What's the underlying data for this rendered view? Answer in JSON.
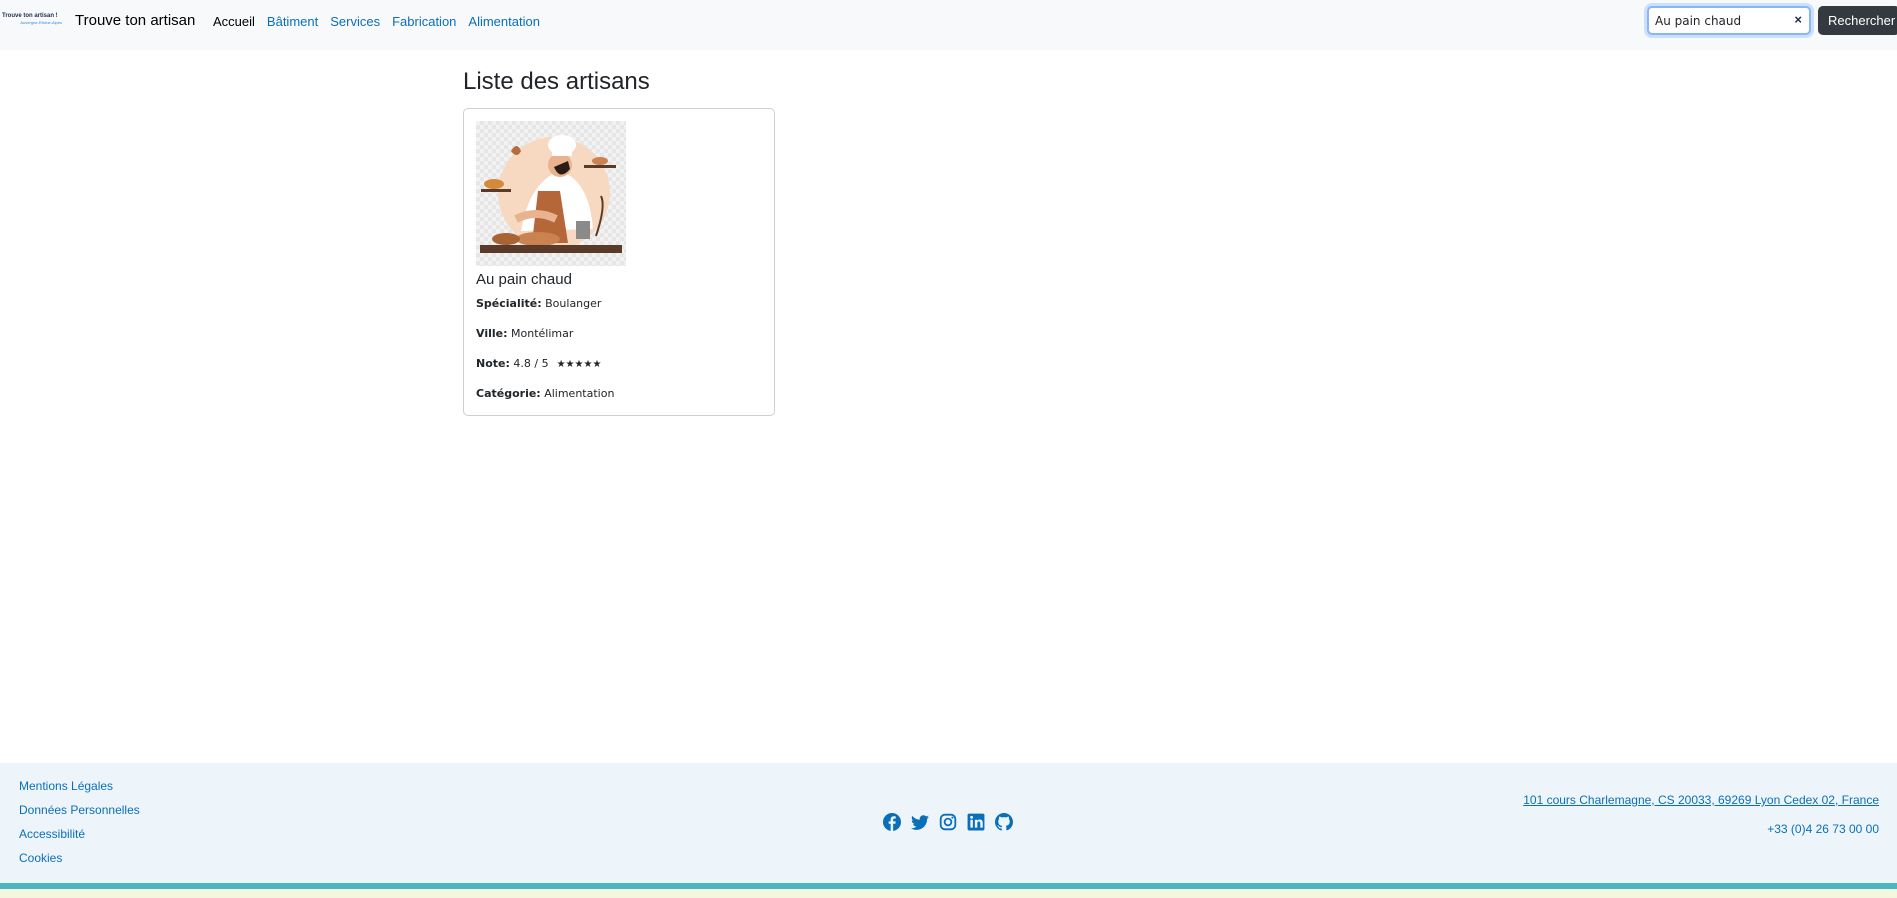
{
  "navbar": {
    "logo_line1": "Trouve ton artisan !",
    "logo_line2": "Auvergne-Rhône-Alpes",
    "brand": "Trouve ton artisan",
    "links": [
      {
        "label": "Accueil"
      },
      {
        "label": "Bâtiment"
      },
      {
        "label": "Services"
      },
      {
        "label": "Fabrication"
      },
      {
        "label": "Alimentation"
      }
    ],
    "search_value": "Au pain chaud",
    "clear_label": "×",
    "search_button": "Rechercher"
  },
  "main": {
    "title": "Liste des artisans",
    "cards": [
      {
        "name": "Au pain chaud",
        "specialite_label": "Spécialité:",
        "specialite": "Boulanger",
        "ville_label": "Ville:",
        "ville": "Montélimar",
        "note_label": "Note:",
        "note": "4.8 / 5",
        "stars": "★★★★★",
        "categorie_label": "Catégorie:",
        "categorie": "Alimentation"
      }
    ]
  },
  "footer": {
    "links": [
      {
        "label": "Mentions Légales"
      },
      {
        "label": "Données Personnelles"
      },
      {
        "label": "Accessibilité"
      },
      {
        "label": "Cookies"
      }
    ],
    "social": [
      "facebook-icon",
      "twitter-icon",
      "instagram-icon",
      "linkedin-icon",
      "github-icon"
    ],
    "address": "101 cours Charlemagne, CS 20033, 69269 Lyon Cedex 02, France",
    "phone": "+33 (0)4 26 73 00 00"
  },
  "colors": {
    "link": "#0a6fb8",
    "navbar_bg": "#f8f9fa",
    "footer_bg": "#edf5fa",
    "button_bg": "#343a40",
    "footer_strip": "#4bb5c1"
  }
}
